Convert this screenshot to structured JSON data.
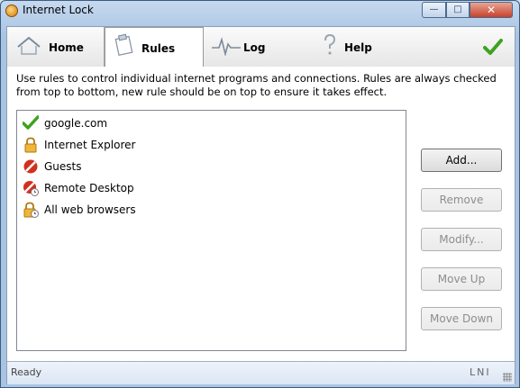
{
  "window": {
    "title": "Internet Lock",
    "close_label": "✕",
    "max_label": "□",
    "min_label": "—"
  },
  "tabs": [
    {
      "label": "Home",
      "icon": "home-icon"
    },
    {
      "label": "Rules",
      "icon": "clipboard-icon",
      "selected": true
    },
    {
      "label": "Log",
      "icon": "pulse-icon"
    },
    {
      "label": "Help",
      "icon": "question-icon"
    }
  ],
  "description": "Use rules to control individual internet programs and connections. Rules are always checked from top to bottom, new rule should be on top to ensure it takes effect.",
  "rules": [
    {
      "label": "google.com",
      "icon": "green-check-icon"
    },
    {
      "label": "Internet Explorer",
      "icon": "lock-icon"
    },
    {
      "label": "Guests",
      "icon": "block-icon"
    },
    {
      "label": "Remote Desktop",
      "icon": "block-clock-icon"
    },
    {
      "label": "All web browsers",
      "icon": "lock-clock-icon"
    }
  ],
  "buttons": {
    "add": "Add...",
    "remove": "Remove",
    "modify": "Modify...",
    "move_up": "Move Up",
    "move_down": "Move Down"
  },
  "status": {
    "left": "Ready",
    "right": "LNI"
  },
  "colors": {
    "accent_green": "#3ca31f",
    "block_red": "#d0301e",
    "lock_gold": "#e0a020"
  }
}
